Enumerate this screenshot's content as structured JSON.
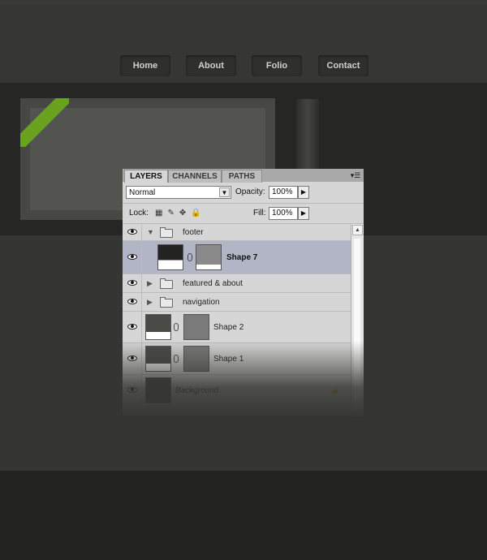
{
  "website": {
    "nav": [
      "Home",
      "About",
      "Folio",
      "Contact"
    ],
    "accent_color": "#6aa11f"
  },
  "panel": {
    "tabs": [
      "LAYERS",
      "CHANNELS",
      "PATHS"
    ],
    "active_tab": "LAYERS",
    "menu_icon": "panel-menu-icon",
    "blend_mode": "Normal",
    "opacity_label": "Opacity:",
    "opacity_value": "100%",
    "lock_label": "Lock:",
    "fill_label": "Fill:",
    "fill_value": "100%",
    "layers": [
      {
        "name": "footer",
        "type": "group",
        "expanded": true
      },
      {
        "name": "Shape 7",
        "type": "shape",
        "selected": true
      },
      {
        "name": "featured & about",
        "type": "group",
        "expanded": false
      },
      {
        "name": "navigation",
        "type": "group",
        "expanded": false
      },
      {
        "name": "Shape 2",
        "type": "shape"
      },
      {
        "name": "Shape 1",
        "type": "shape"
      },
      {
        "name": "Background",
        "type": "background",
        "locked": true
      }
    ]
  }
}
